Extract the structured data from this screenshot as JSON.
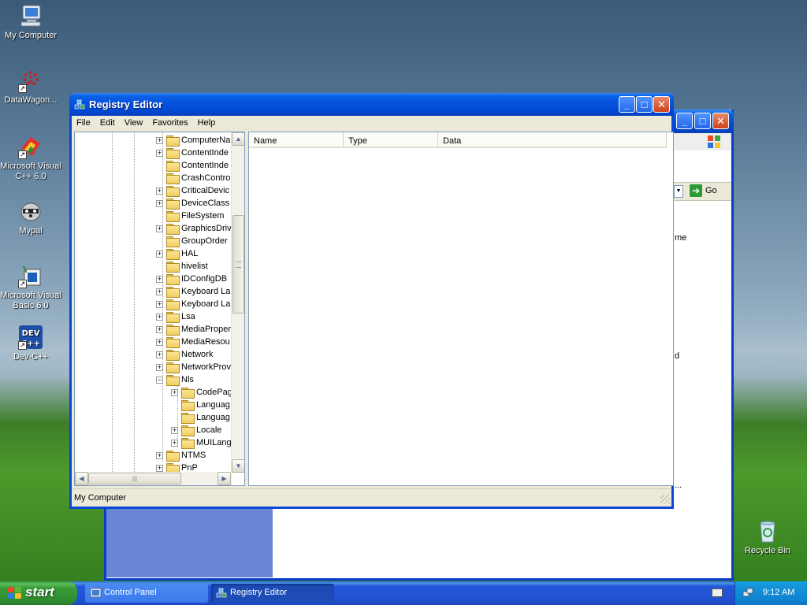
{
  "desktop": {
    "icons": [
      {
        "label": "My Computer"
      },
      {
        "label": "DataWagon..."
      },
      {
        "label": "Microsoft Visual C++ 6.0"
      },
      {
        "label": "Mypal"
      },
      {
        "label": "Microsoft Visual Basic 6.0"
      },
      {
        "label": "Dev-C++"
      },
      {
        "label": "Recycle Bin"
      }
    ]
  },
  "background_window": {
    "go_label": "Go",
    "fragments": [
      "me",
      "d",
      "..."
    ]
  },
  "registry_editor": {
    "title": "Registry Editor",
    "menu": [
      "File",
      "Edit",
      "View",
      "Favorites",
      "Help"
    ],
    "tree_items": [
      {
        "label": "ComputerNa",
        "expandable": true,
        "level": 1
      },
      {
        "label": "ContentInde",
        "expandable": true,
        "level": 1
      },
      {
        "label": "ContentInde",
        "expandable": false,
        "level": 1
      },
      {
        "label": "CrashContro",
        "expandable": false,
        "level": 1
      },
      {
        "label": "CriticalDevic",
        "expandable": true,
        "level": 1
      },
      {
        "label": "DeviceClass",
        "expandable": true,
        "level": 1
      },
      {
        "label": "FileSystem",
        "expandable": false,
        "level": 1
      },
      {
        "label": "GraphicsDriv",
        "expandable": true,
        "level": 1
      },
      {
        "label": "GroupOrder",
        "expandable": false,
        "level": 1
      },
      {
        "label": "HAL",
        "expandable": true,
        "level": 1
      },
      {
        "label": "hivelist",
        "expandable": false,
        "level": 1
      },
      {
        "label": "IDConfigDB",
        "expandable": true,
        "level": 1
      },
      {
        "label": "Keyboard La",
        "expandable": true,
        "level": 1
      },
      {
        "label": "Keyboard La",
        "expandable": true,
        "level": 1
      },
      {
        "label": "Lsa",
        "expandable": true,
        "level": 1
      },
      {
        "label": "MediaProper",
        "expandable": true,
        "level": 1
      },
      {
        "label": "MediaResou",
        "expandable": true,
        "level": 1
      },
      {
        "label": "Network",
        "expandable": true,
        "level": 1
      },
      {
        "label": "NetworkProv",
        "expandable": true,
        "level": 1
      },
      {
        "label": "Nls",
        "expandable": true,
        "expanded": true,
        "level": 1
      },
      {
        "label": "CodePag",
        "expandable": true,
        "level": 2
      },
      {
        "label": "Languag",
        "expandable": false,
        "level": 2
      },
      {
        "label": "Languag",
        "expandable": false,
        "level": 2
      },
      {
        "label": "Locale",
        "expandable": true,
        "level": 2
      },
      {
        "label": "MUILang",
        "expandable": true,
        "level": 2
      },
      {
        "label": "NTMS",
        "expandable": true,
        "level": 1
      },
      {
        "label": "PnP",
        "expandable": true,
        "level": 1
      }
    ],
    "columns": [
      "Name",
      "Type",
      "Data"
    ],
    "status": "My Computer"
  },
  "taskbar": {
    "start_label": "start",
    "tasks": [
      {
        "label": "Control Panel",
        "active": false
      },
      {
        "label": "Registry Editor",
        "active": true
      }
    ],
    "clock": "9:12 AM"
  }
}
